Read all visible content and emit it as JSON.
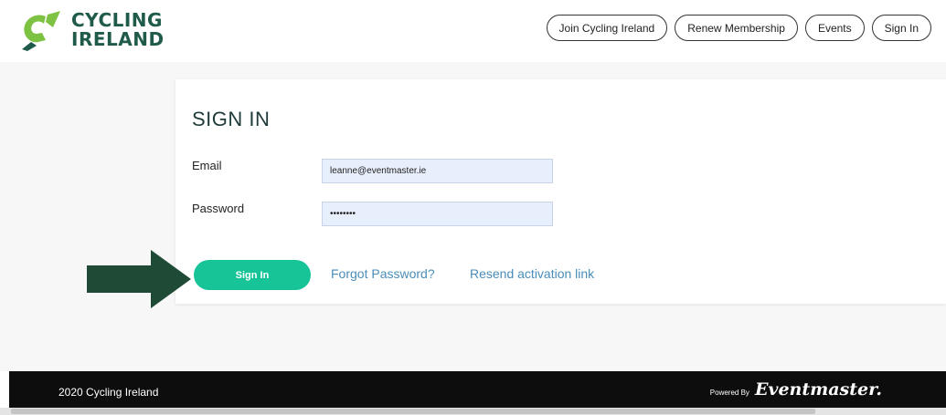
{
  "brand": {
    "line1": "CYCLING",
    "line2": "IRELAND",
    "color": "#1f5a4a",
    "accent": "#7dc243"
  },
  "nav": {
    "items": [
      {
        "id": "join",
        "label": "Join Cycling Ireland"
      },
      {
        "id": "renew",
        "label": "Renew Membership"
      },
      {
        "id": "events",
        "label": "Events"
      },
      {
        "id": "signin",
        "label": "Sign In"
      }
    ]
  },
  "form": {
    "title": "SIGN IN",
    "email_label": "Email",
    "email_value": "leanne@eventmaster.ie",
    "password_label": "Password",
    "password_value": "••••••••",
    "submit_label": "Sign In",
    "forgot_label": "Forgot Password?",
    "resend_label": "Resend activation link"
  },
  "footer": {
    "copyright": "2020 Cycling Ireland",
    "powered_label": "Powered By",
    "powered_brand": "Eventmaster."
  },
  "colors": {
    "primary_button": "#17c497",
    "link": "#4a8db8",
    "arrow": "#1e4a36",
    "footer_bg": "#0d0d0d"
  }
}
